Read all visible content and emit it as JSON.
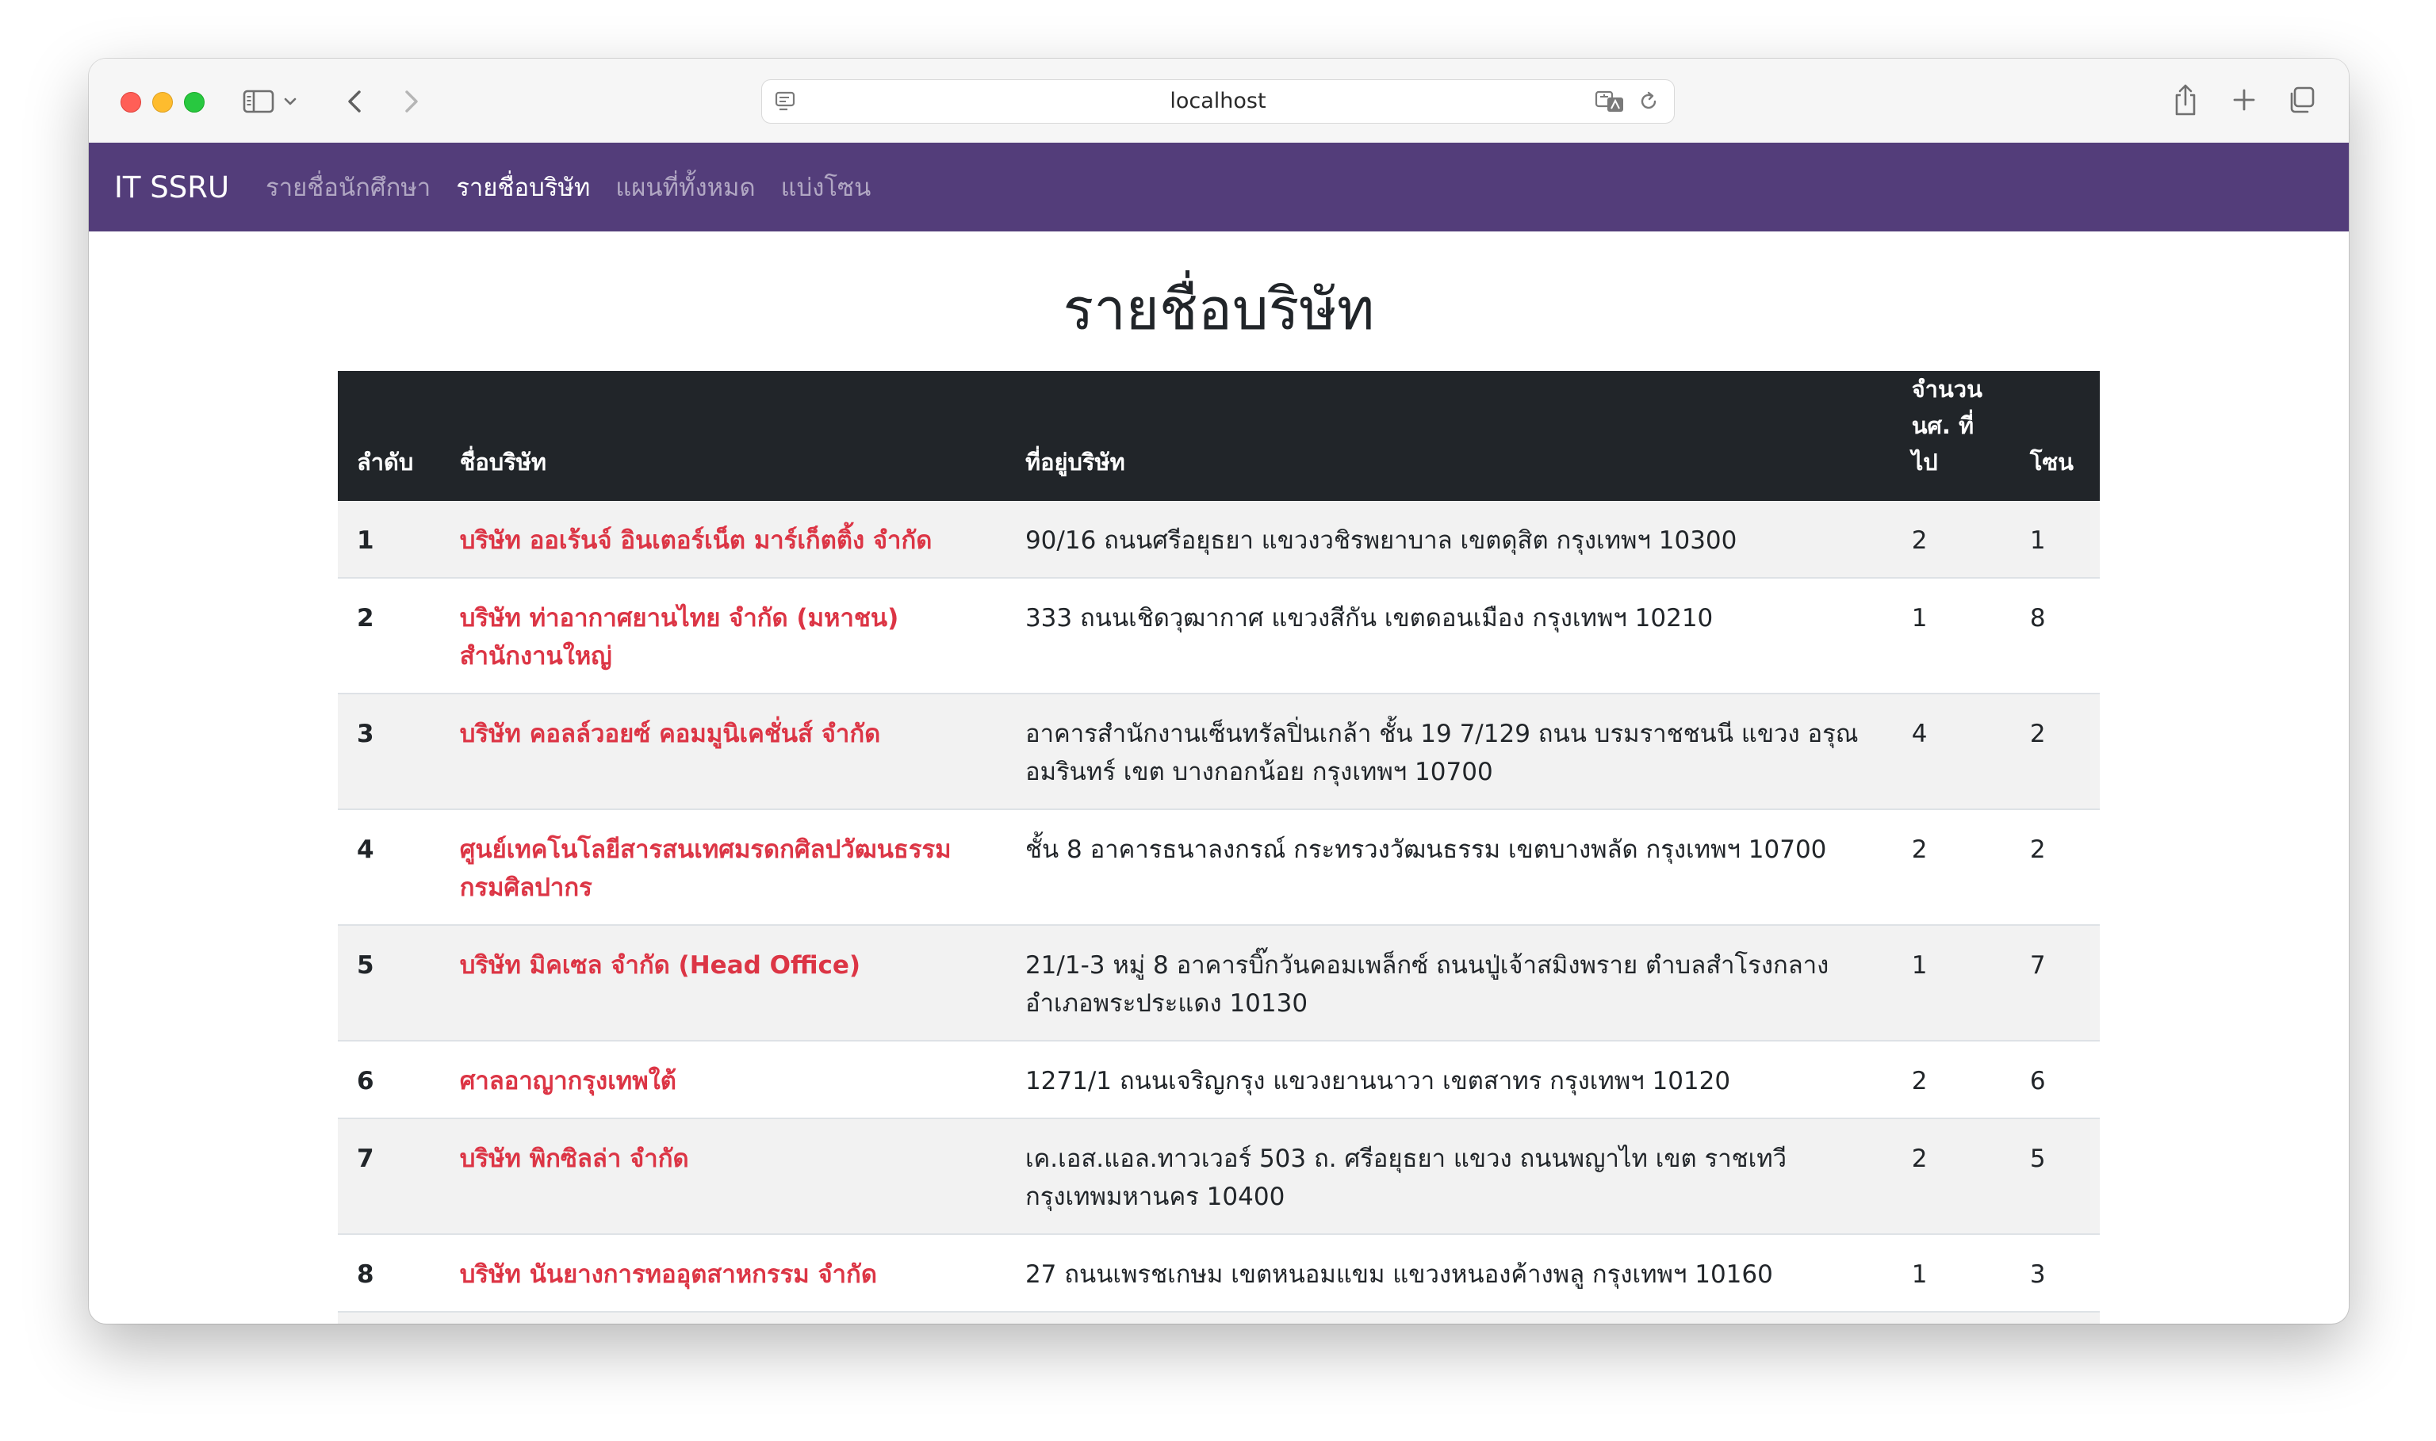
{
  "browser": {
    "url": "localhost"
  },
  "navbar": {
    "brand": "IT SSRU",
    "links": [
      {
        "label": "รายชื่อนักศึกษา",
        "active": false
      },
      {
        "label": "รายชื่อบริษัท",
        "active": true
      },
      {
        "label": "แผนที่ทั้งหมด",
        "active": false
      },
      {
        "label": "แบ่งโซน",
        "active": false
      }
    ]
  },
  "page": {
    "title": "รายชื่อบริษัท"
  },
  "table": {
    "headers": {
      "index": "ลำดับ",
      "name": "ชื่อบริษัท",
      "address": "ที่อยู่บริษัท",
      "count_line1": "จำนวน",
      "count_line2": "นศ. ที่ไป",
      "zone": "โซน"
    },
    "rows": [
      {
        "index": "1",
        "name": "บริษัท ออเร้นจ์ อินเตอร์เน็ต มาร์เก็ตติ้ง จำกัด",
        "address": "90/16 ถนนศรีอยุธยา แขวงวชิรพยาบาล เขตดุสิต กรุงเทพฯ 10300",
        "count": "2",
        "zone": "1"
      },
      {
        "index": "2",
        "name": "บริษัท ท่าอากาศยานไทย จำกัด (มหาชน) สำนักงานใหญ่",
        "address": "333 ถนนเชิดวุฒากาศ แขวงสีกัน เขตดอนเมือง กรุงเทพฯ 10210",
        "count": "1",
        "zone": "8"
      },
      {
        "index": "3",
        "name": "บริษัท คอลล์วอยซ์ คอมมูนิเคชั่นส์ จำกัด",
        "address": "อาคารสำนักงานเซ็นทรัลปิ่นเกล้า ชั้น 19 7/129 ถนน บรมราชชนนี แขวง อรุณอมรินทร์ เขต บางกอกน้อย กรุงเทพฯ 10700",
        "count": "4",
        "zone": "2"
      },
      {
        "index": "4",
        "name": "ศูนย์เทคโนโลยีสารสนเทศมรดกศิลปวัฒนธรรม กรมศิลปากร",
        "address": "ชั้น 8 อาคารธนาลงกรณ์ กระทรวงวัฒนธรรม เขตบางพลัด กรุงเทพฯ 10700",
        "count": "2",
        "zone": "2"
      },
      {
        "index": "5",
        "name": "บริษัท มิคเซล จำกัด (Head Office)",
        "address": "21/1-3 หมู่ 8 อาคารบิ๊กวันคอมเพล็กซ์ ถนนปู่เจ้าสมิงพราย ตำบลสำโรงกลาง อำเภอพระประแดง 10130",
        "count": "1",
        "zone": "7"
      },
      {
        "index": "6",
        "name": "ศาลอาญากรุงเทพใต้",
        "address": "1271/1 ถนนเจริญกรุง แขวงยานนาวา เขตสาทร กรุงเทพฯ 10120",
        "count": "2",
        "zone": "6"
      },
      {
        "index": "7",
        "name": "บริษัท พิกซิลล่า จำกัด",
        "address": "เค.เอส.แอล.ทาวเวอร์ 503 ถ. ศรีอยุธยา แขวง ถนนพญาไท เขต ราชเทวี กรุงเทพมหานคร 10400",
        "count": "2",
        "zone": "5"
      },
      {
        "index": "8",
        "name": "บริษัท นันยางการทออุตสาหกรรม จำกัด",
        "address": "27 ถนนเพรชเกษม เขตหนอมแขม แขวงหนองค้างพลู กรุงเทพฯ 10160",
        "count": "1",
        "zone": "3"
      }
    ]
  }
}
